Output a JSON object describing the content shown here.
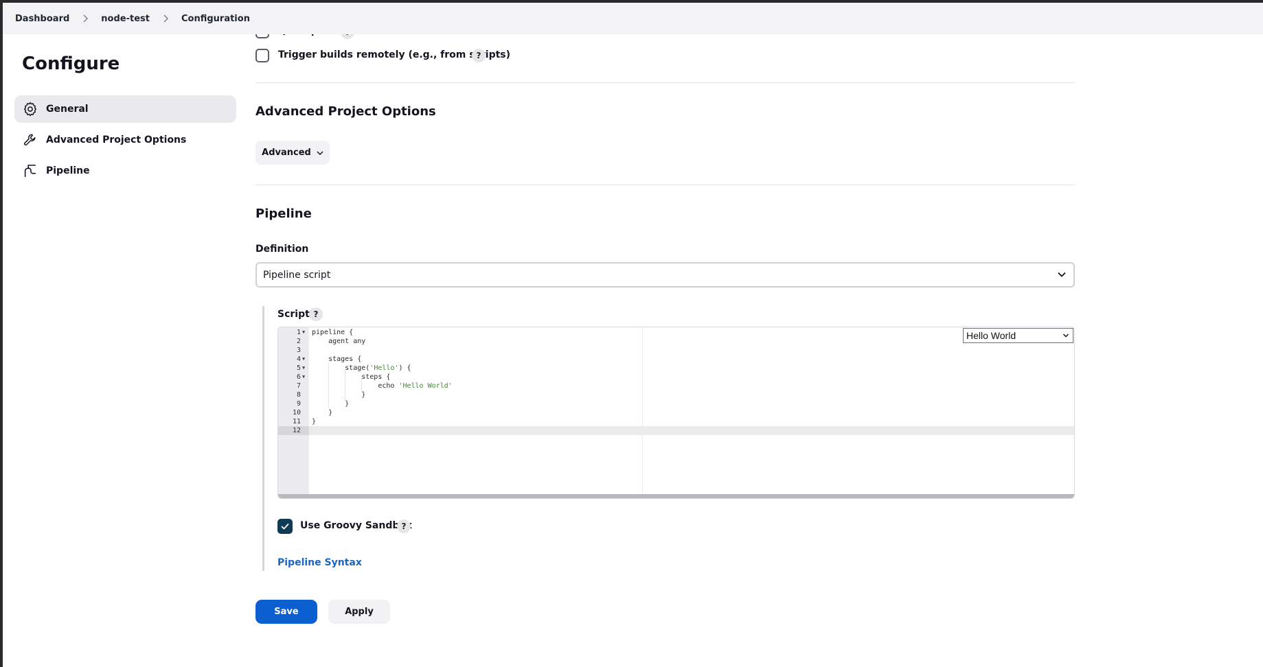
{
  "breadcrumb": {
    "items": [
      "Dashboard",
      "node-test",
      "Configuration"
    ]
  },
  "sidebar": {
    "title": "Configure",
    "items": [
      {
        "label": "General",
        "icon": "gear-icon",
        "active": true
      },
      {
        "label": "Advanced Project Options",
        "icon": "wrench-icon",
        "active": false
      },
      {
        "label": "Pipeline",
        "icon": "pipeline-icon",
        "active": false
      }
    ]
  },
  "triggers": {
    "quiet_period_label": "Quiet period",
    "trigger_remote_label": "Trigger builds remotely (e.g., from scripts)",
    "help": "?"
  },
  "advanced_section": {
    "title": "Advanced Project Options",
    "button_label": "Advanced"
  },
  "pipeline_section": {
    "title": "Pipeline",
    "definition_label": "Definition",
    "definition_value": "Pipeline script",
    "script_label": "Script",
    "script_help": "?",
    "sample_select_value": "Hello World",
    "code_lines": [
      "pipeline {",
      "    agent any",
      "",
      "    stages {",
      "        stage('Hello') {",
      "            steps {",
      "                echo 'Hello World'",
      "            }",
      "        }",
      "    }",
      "}",
      ""
    ],
    "sandbox_label": "Use Groovy Sandbox",
    "sandbox_checked": true,
    "sandbox_help": "?",
    "syntax_link": "Pipeline Syntax"
  },
  "actions": {
    "save_label": "Save",
    "apply_label": "Apply"
  },
  "colors": {
    "primary": "#0b5fd1",
    "link": "#1b65c4",
    "checkbox_checked": "#0f3b57",
    "string_literal": "#3f8d2c"
  }
}
